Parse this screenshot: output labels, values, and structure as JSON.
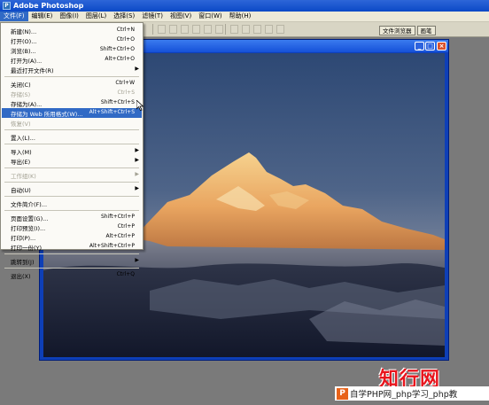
{
  "window": {
    "title": "Adobe Photoshop"
  },
  "menubar": [
    "文件(F)",
    "编辑(E)",
    "图像(I)",
    "图层(L)",
    "选择(S)",
    "滤镜(T)",
    "视图(V)",
    "窗口(W)",
    "帮助(H)"
  ],
  "palette_well": [
    "文件浏览器",
    "画笔"
  ],
  "file_menu": [
    {
      "label": "新建(N)...",
      "shortcut": "Ctrl+N"
    },
    {
      "label": "打开(O)...",
      "shortcut": "Ctrl+O"
    },
    {
      "label": "浏览(B)...",
      "shortcut": "Shift+Ctrl+O"
    },
    {
      "label": "打开为(A)...",
      "shortcut": "Alt+Ctrl+O"
    },
    {
      "label": "最近打开文件(R)",
      "submenu": true
    },
    {
      "separator": true
    },
    {
      "label": "关闭(C)",
      "shortcut": "Ctrl+W"
    },
    {
      "label": "存储(S)",
      "shortcut": "Ctrl+S",
      "disabled": true
    },
    {
      "label": "存储为(A)...",
      "shortcut": "Shift+Ctrl+S"
    },
    {
      "label": "存储为 Web 所用格式(W)...",
      "shortcut": "Alt+Shift+Ctrl+S",
      "highlighted": true
    },
    {
      "label": "恢复(V)",
      "disabled": true
    },
    {
      "separator": true
    },
    {
      "label": "置入(L)..."
    },
    {
      "separator": true
    },
    {
      "label": "导入(M)",
      "submenu": true
    },
    {
      "label": "导出(E)",
      "submenu": true
    },
    {
      "separator": true
    },
    {
      "label": "工作组(K)",
      "submenu": true,
      "disabled": true
    },
    {
      "separator": true
    },
    {
      "label": "自动(U)",
      "submenu": true
    },
    {
      "separator": true
    },
    {
      "label": "文件简介(F)..."
    },
    {
      "separator": true
    },
    {
      "label": "页面设置(G)...",
      "shortcut": "Shift+Ctrl+P"
    },
    {
      "label": "打印预览(I)...",
      "shortcut": "Ctrl+P"
    },
    {
      "label": "打印(P)...",
      "shortcut": "Alt+Ctrl+P"
    },
    {
      "label": "打印一份(Y)",
      "shortcut": "Alt+Shift+Ctrl+P"
    },
    {
      "separator": true
    },
    {
      "label": "跳转到(J)",
      "submenu": true
    },
    {
      "separator": true
    },
    {
      "label": "退出(X)",
      "shortcut": "Ctrl+Q"
    }
  ],
  "watermark": {
    "brand": "知行网",
    "logo_letter": "P",
    "bar_text": "自学PHP网_php学习_php教"
  },
  "colors": {
    "titlebar": "#0b49c6",
    "highlight": "#316ac5",
    "watermark_red": "#e8151d"
  },
  "icons": [
    "photoshop-app-icon",
    "minimize-icon",
    "maximize-icon",
    "close-icon",
    "submenu-arrow-icon",
    "mouse-cursor-icon"
  ]
}
